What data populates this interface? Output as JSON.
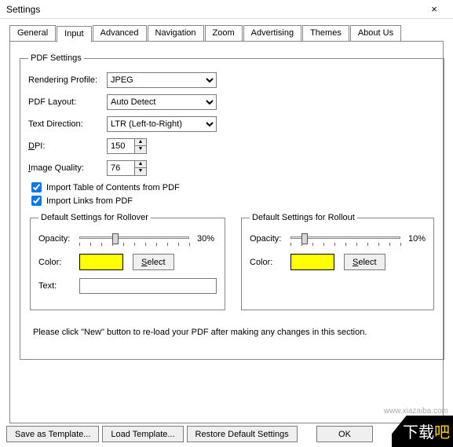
{
  "window": {
    "title": "Settings",
    "close": "×"
  },
  "tabs": {
    "general": "General",
    "input": "Input",
    "advanced": "Advanced",
    "navigation": "Navigation",
    "zoom": "Zoom",
    "advertising": "Advertising",
    "themes": "Themes",
    "about": "About Us"
  },
  "pdf": {
    "legend": "PDF Settings",
    "rendering_label": "Rendering Profile:",
    "rendering_value": "JPEG",
    "layout_label": "PDF Layout:",
    "layout_value": "Auto Detect",
    "textdir_label": "Text Direction:",
    "textdir_value": "LTR (Left-to-Right)",
    "dpi_label_prefix": "D",
    "dpi_label_rest": "PI:",
    "dpi_value": "150",
    "iq_label_prefix": "I",
    "iq_label_rest": "mage Quality:",
    "iq_value": "76",
    "import_toc": "Import Table of Contents from PDF",
    "import_links": "Import Links from PDF",
    "rollover": {
      "legend": "Default Settings for Rollover",
      "opacity_label": "Opacity:",
      "opacity_value": "30%",
      "color_label": "Color:",
      "color_hex": "#ffff00",
      "select_prefix": "S",
      "select_rest": "elect",
      "text_label": "Text:",
      "text_value": ""
    },
    "rollout": {
      "legend": "Default Settings for Rollout",
      "opacity_label": "Opacity:",
      "opacity_value": "10%",
      "color_label": "Color:",
      "color_hex": "#ffff00",
      "select_prefix": "S",
      "select_rest": "elect"
    },
    "note": "Please click \"New\" button to re-load your PDF after making any changes in this section."
  },
  "footer": {
    "save_template": "Save as Template...",
    "load_template": "Load Template...",
    "restore": "Restore Default Settings",
    "ok": "OK"
  },
  "watermark": "www.xiazaiba.com",
  "logo": {
    "a": "下载",
    "b": "吧"
  }
}
